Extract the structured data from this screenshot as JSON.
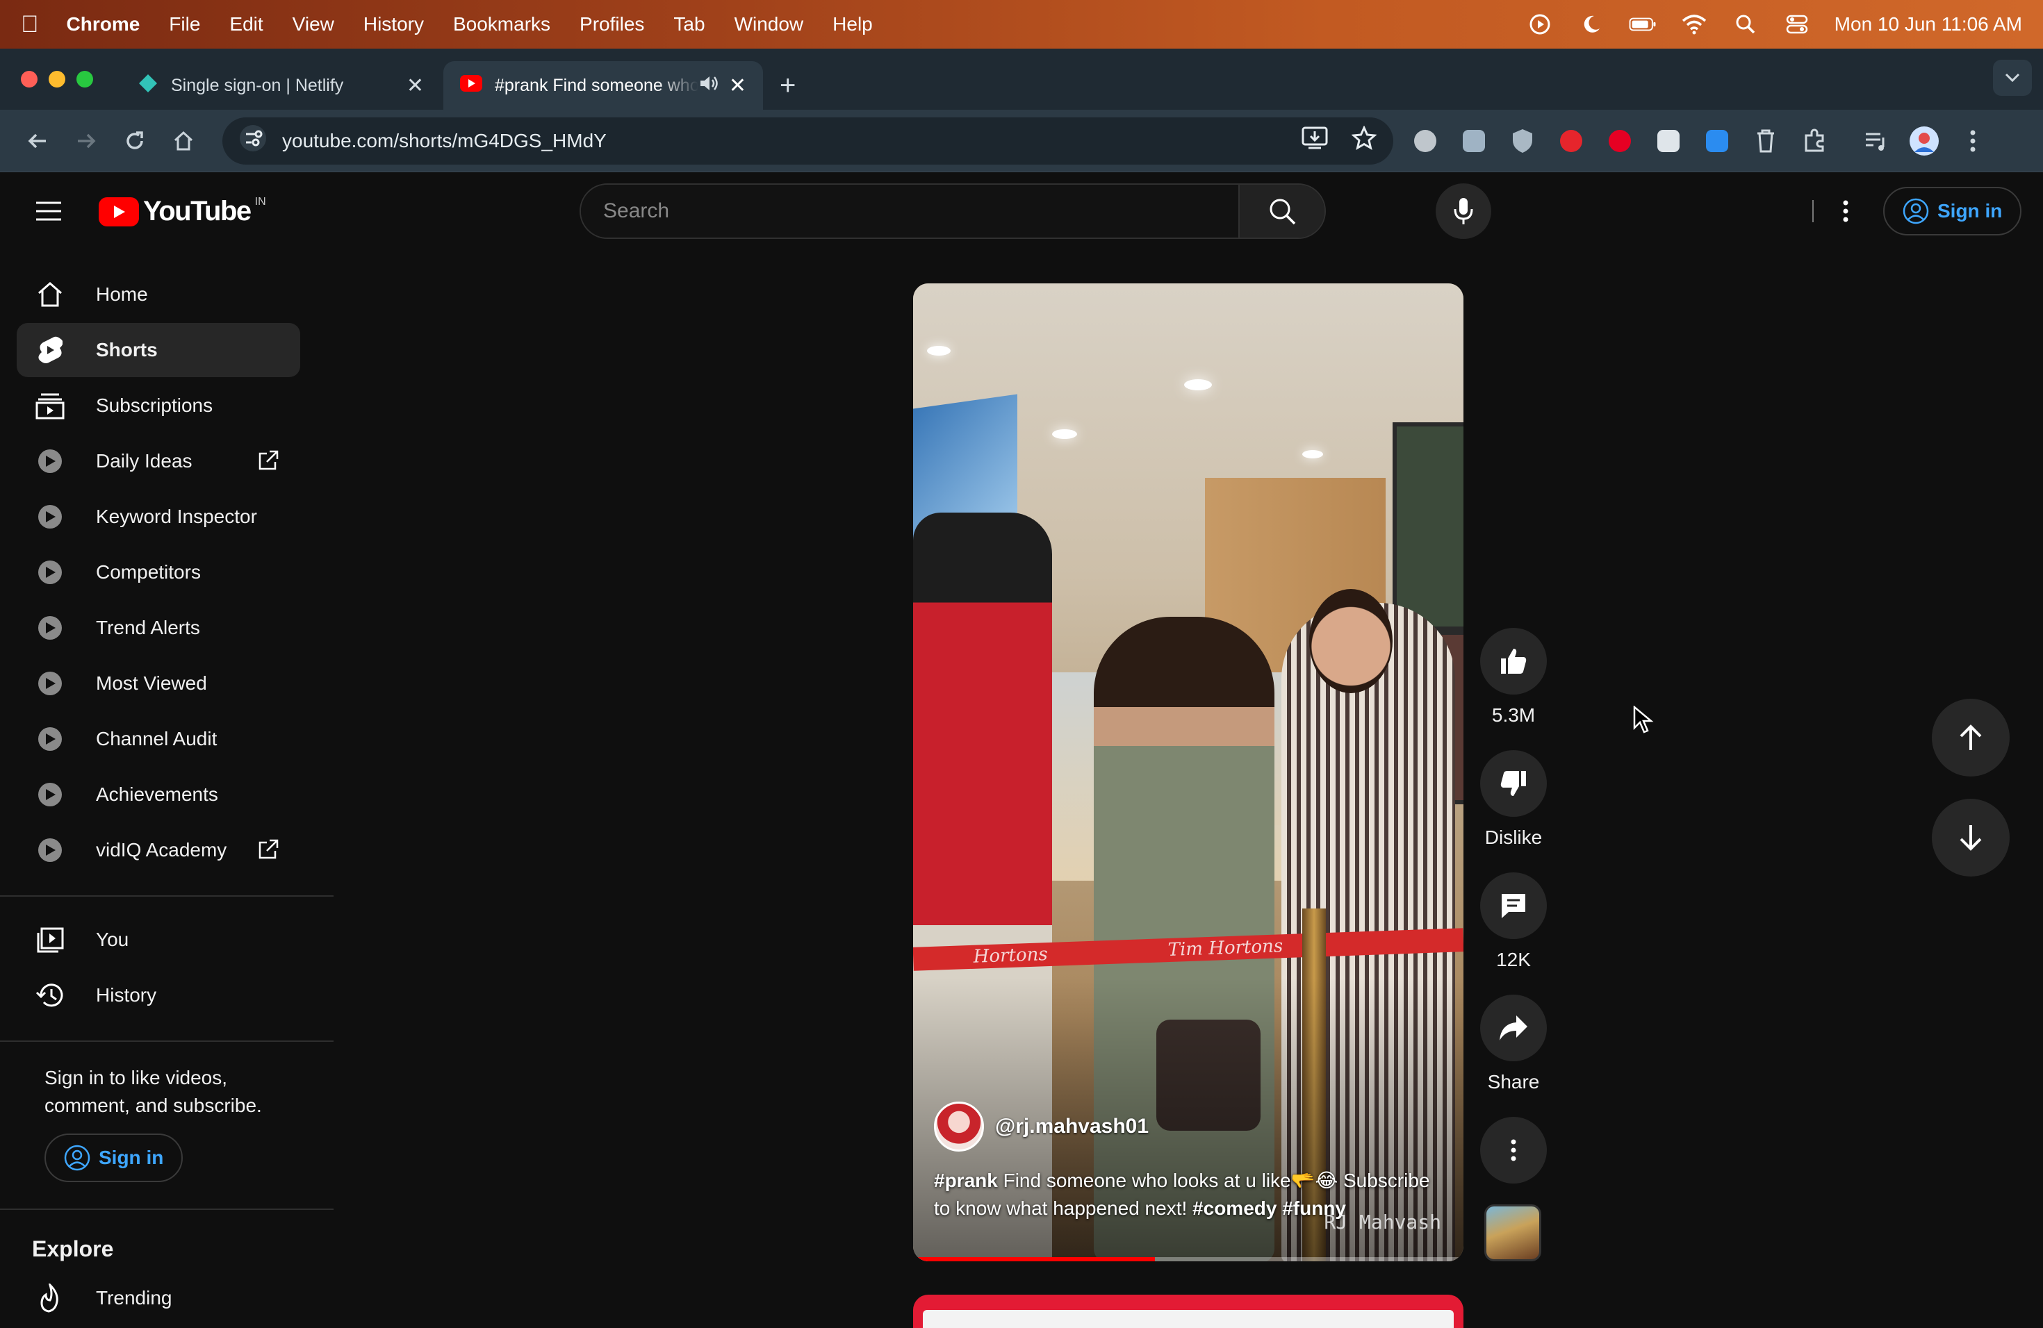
{
  "menubar": {
    "app": "Chrome",
    "items": [
      "File",
      "Edit",
      "View",
      "History",
      "Bookmarks",
      "Profiles",
      "Tab",
      "Window",
      "Help"
    ],
    "clock": "Mon 10 Jun  11:06 AM"
  },
  "tabs": [
    {
      "title": "Single sign-on | Netlify",
      "icon": "netlify-icon",
      "active": false
    },
    {
      "title": "#prank Find someone who looks at u like",
      "icon": "youtube-icon",
      "active": true
    }
  ],
  "toolbar": {
    "url": "youtube.com/shorts/mG4DGS_HMdY"
  },
  "masthead": {
    "logo_text": "YouTube",
    "country_code": "IN",
    "search_placeholder": "Search",
    "signin_label": "Sign in"
  },
  "sidebar": {
    "main": [
      {
        "label": "Home",
        "icon": "home-icon"
      },
      {
        "label": "Shorts",
        "icon": "shorts-icon",
        "active": true
      },
      {
        "label": "Subscriptions",
        "icon": "subscriptions-icon"
      }
    ],
    "vidiq": [
      {
        "label": "Daily Ideas",
        "external": true
      },
      {
        "label": "Keyword Inspector"
      },
      {
        "label": "Competitors"
      },
      {
        "label": "Trend Alerts"
      },
      {
        "label": "Most Viewed"
      },
      {
        "label": "Channel Audit"
      },
      {
        "label": "Achievements"
      },
      {
        "label": "vidIQ Academy",
        "external": true
      }
    ],
    "you": [
      {
        "label": "You",
        "icon": "you-icon"
      },
      {
        "label": "History",
        "icon": "history-icon"
      }
    ],
    "signin_note": "Sign in to like videos, comment, and subscribe.",
    "signin_label": "Sign in",
    "explore_title": "Explore",
    "explore": [
      {
        "label": "Trending",
        "icon": "trending-icon"
      }
    ]
  },
  "short": {
    "channel": "@rj.mahvash01",
    "caption_tag": "#prank",
    "caption_text": " Find someone who looks at u like🫳😂 Subscribe to know what happened next! ",
    "caption_tags_end": "#comedy #funny",
    "watermark": "RJ Mahvash",
    "store_sign_1": "Tim Hortons",
    "store_sign_2": "Hortons",
    "progress": 0.44,
    "likes": "5.3M",
    "dislike_label": "Dislike",
    "comments": "12K",
    "share_label": "Share"
  },
  "colors": {
    "accent": "#ff0000",
    "link": "#3ea6ff",
    "background": "#0f0f0f",
    "chip": "#272727"
  }
}
